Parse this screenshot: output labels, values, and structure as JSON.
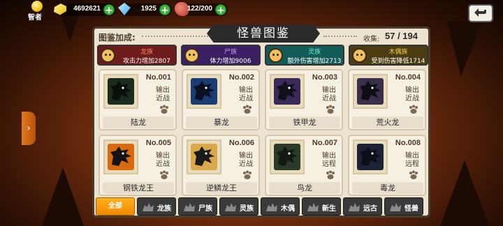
{
  "resources": {
    "player_title": "智者",
    "gold": "4692621",
    "gems": "1925",
    "stamina": "122/200"
  },
  "panel": {
    "title": "怪兽图鉴",
    "bonus_label": "图鉴加成:",
    "collect_label": "收集:",
    "collect_value": "57 / 194"
  },
  "bonuses": [
    {
      "name": "龙族",
      "desc": "攻击力增加2807",
      "bg": "#6e1b1b",
      "name_color": "#ff8a5a"
    },
    {
      "name": "尸族",
      "desc": "体力增加9006",
      "bg": "#3a1f62",
      "name_color": "#c99bff"
    },
    {
      "name": "灵族",
      "desc": "额外伤害增加2713",
      "bg": "#145a56",
      "name_color": "#6ff2d8"
    },
    {
      "name": "木偶族",
      "desc": "受到伤害降低1714",
      "bg": "#4b3c12",
      "name_color": "#f8d34a"
    }
  ],
  "cards": [
    {
      "num": "No.001",
      "stat1": "输出",
      "stat2": "近战",
      "name": "陆龙",
      "bg": "#1b2b1d",
      "body": "#0b0f0b"
    },
    {
      "num": "No.002",
      "stat1": "输出",
      "stat2": "近战",
      "name": "暴龙",
      "bg": "#1a3c72",
      "body": "#0c1020"
    },
    {
      "num": "No.003",
      "stat1": "输出",
      "stat2": "近战",
      "name": "铁甲龙",
      "bg": "#3a2a5a",
      "body": "#101018"
    },
    {
      "num": "No.004",
      "stat1": "输出",
      "stat2": "近战",
      "name": "荒火龙",
      "bg": "#3a2f4a",
      "body": "#0e0e14"
    },
    {
      "num": "No.005",
      "stat1": "输出",
      "stat2": "近战",
      "name": "钢铁龙王",
      "bg": "#d86b10",
      "body": "#141414"
    },
    {
      "num": "No.006",
      "stat1": "输出",
      "stat2": "近战",
      "name": "逆鳞龙王",
      "bg": "#d9a84a",
      "body": "#1a1a1a"
    },
    {
      "num": "No.007",
      "stat1": "输出",
      "stat2": "远程",
      "name": "鸟龙",
      "bg": "#2c3a2a",
      "body": "#121812"
    },
    {
      "num": "No.008",
      "stat1": "输出",
      "stat2": "远程",
      "name": "毒龙",
      "bg": "#1e2236",
      "body": "#0c0e18"
    }
  ],
  "tabs": [
    {
      "label": "全部"
    },
    {
      "label": "龙族"
    },
    {
      "label": "尸族"
    },
    {
      "label": "灵族"
    },
    {
      "label": "木偶"
    },
    {
      "label": "新生"
    },
    {
      "label": "远古"
    },
    {
      "label": "怪兽"
    }
  ]
}
